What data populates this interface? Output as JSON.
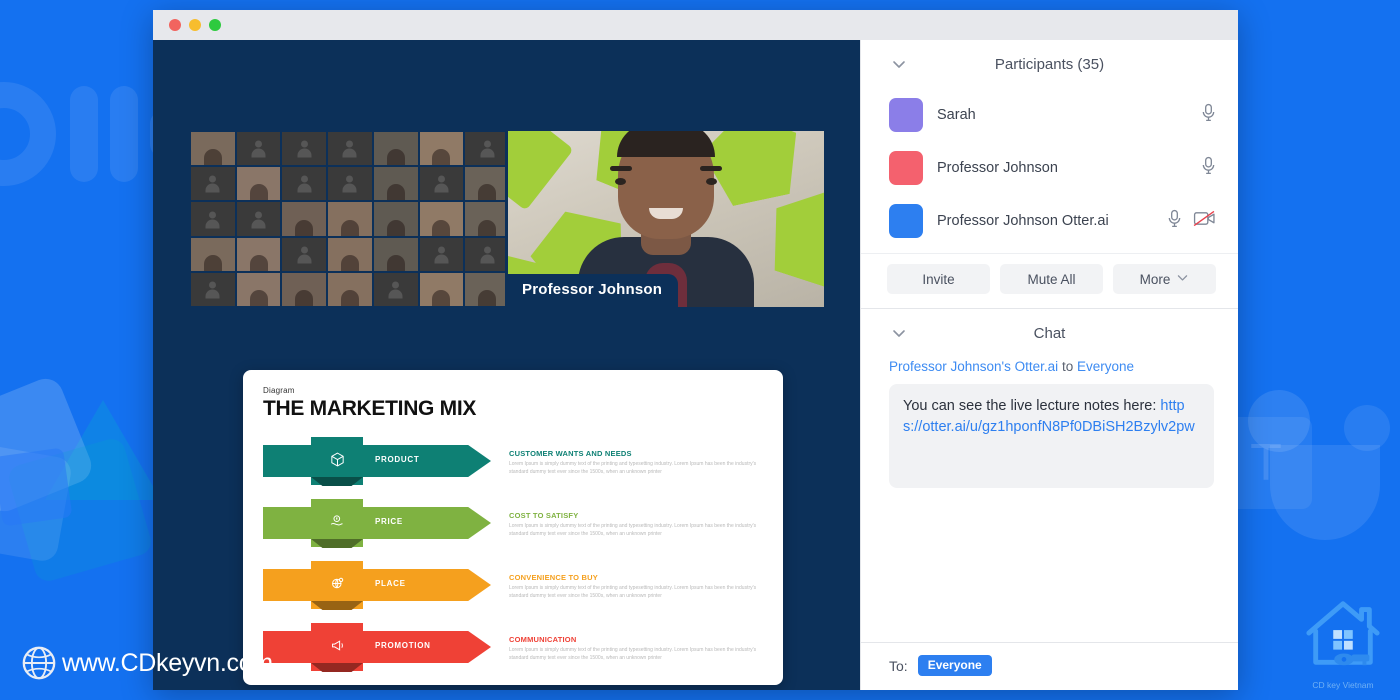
{
  "window": {
    "traffic_lights": [
      "close",
      "minimize",
      "maximize"
    ]
  },
  "stage": {
    "speaker": {
      "name_plate": "Professor Johnson"
    },
    "gallery": {
      "columns": 7,
      "rows": 5,
      "faces": [
        0,
        4,
        5,
        8,
        11,
        13,
        16,
        17,
        18,
        19,
        20,
        21,
        22,
        24,
        25,
        29,
        30,
        31,
        33,
        34
      ]
    }
  },
  "slide": {
    "eyebrow": "Diagram",
    "title": "THE MARKETING MIX",
    "rows": [
      {
        "label": "PRODUCT",
        "icon": "box-icon",
        "color": "#0E8074",
        "head": "CUSTOMER WANTS AND NEEDS",
        "body": "Lorem Ipsum is simply dummy text of the printing and typesetting industry. Lorem Ipsum has been the industry's standard dummy text ever since the 1500s, when an unknown printer"
      },
      {
        "label": "PRICE",
        "icon": "hand-coin-icon",
        "color": "#7FB241",
        "head": "COST TO SATISFY",
        "body": "Lorem Ipsum is simply dummy text of the printing and typesetting industry. Lorem Ipsum has been the industry's standard dummy text ever since the 1500s, when an unknown printer"
      },
      {
        "label": "PLACE",
        "icon": "globe-pin-icon",
        "color": "#F5A01E",
        "head": "CONVENIENCE TO BUY",
        "body": "Lorem Ipsum is simply dummy text of the printing and typesetting industry. Lorem Ipsum has been the industry's standard dummy text ever since the 1500s, when an unknown printer"
      },
      {
        "label": "PROMOTION",
        "icon": "megaphone-icon",
        "color": "#EF4136",
        "head": "COMMUNICATION",
        "body": "Lorem Ipsum is simply dummy text of the printing and typesetting industry. Lorem Ipsum has been the industry's standard dummy text ever since the 1500s, when an unknown printer"
      }
    ]
  },
  "participants_panel": {
    "title": "Participants (35)",
    "collapse_icon": "chevron-down-icon",
    "rows": [
      {
        "name": "Sarah",
        "avatar_color": "#8B7EE8",
        "mic": "mic-icon",
        "camera": null
      },
      {
        "name": "Professor Johnson",
        "avatar_color": "#F4616E",
        "mic": "mic-icon",
        "camera": null
      },
      {
        "name": "Professor Johnson Otter.ai",
        "avatar_color": "#2D7FF0",
        "mic": "mic-icon",
        "camera": "camera-off-icon"
      }
    ],
    "actions": [
      {
        "label": "Invite",
        "icon": null
      },
      {
        "label": "Mute All",
        "icon": null
      },
      {
        "label": "More",
        "icon": "chevron-down-icon"
      }
    ]
  },
  "chat_panel": {
    "title": "Chat",
    "collapse_icon": "chevron-down-icon",
    "sender": "Professor Johnson's Otter.ai",
    "to_word": "to",
    "recipient": "Everyone",
    "message_prefix": "You can see the live lecture notes here: ",
    "message_link": "https://otter.ai/u/gz1hponfN8Pf0DBiSH2Bzylv2pw",
    "footer_to_label": "To:",
    "footer_recipient": "Everyone"
  },
  "branding": {
    "site": "www.CDkeyvn.com",
    "site_icon": "globe-icon",
    "logo_caption": "CD key Vietnam",
    "logo_icon": "house-key-icon"
  },
  "background": {
    "page_color": "#1471F0",
    "otter_watermark": "otter-logo-watermark",
    "teams_watermark": "teams-logo-watermark",
    "shapes_watermark": "shapes-watermark"
  }
}
